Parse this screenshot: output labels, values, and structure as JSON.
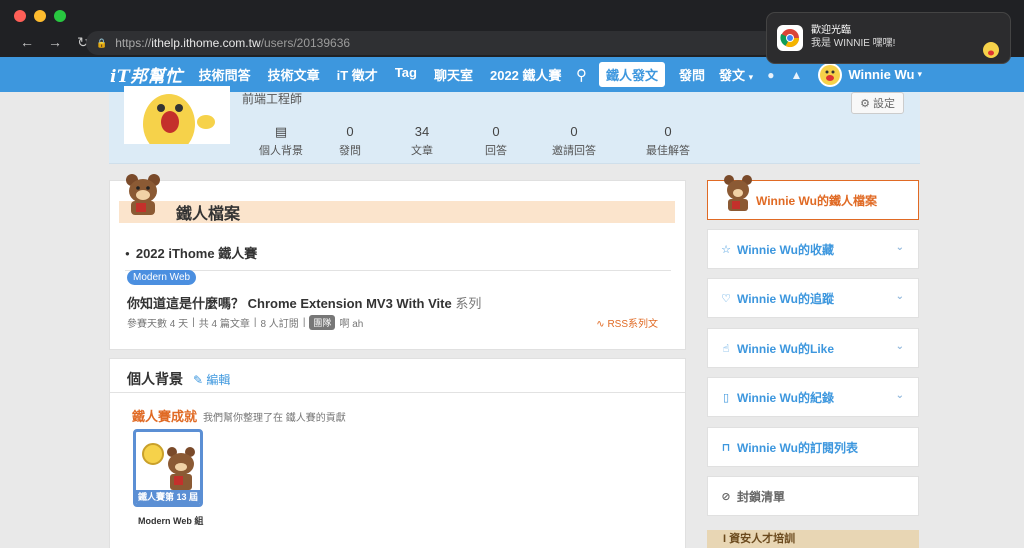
{
  "browser": {
    "url_scheme": "https://",
    "url_host": "ithelp.ithome.com.tw",
    "url_path": "/users/20139636"
  },
  "notification": {
    "title": "歡迎光臨",
    "message": "我是 WINNIE 嘿嘿!"
  },
  "site_nav": {
    "logo": "iT邦幫忙",
    "links": [
      "技術問答",
      "技術文章",
      "iT 徵才",
      "Tag",
      "聊天室",
      "2022 鐵人賽"
    ],
    "post_button": "鐵人發文",
    "ask": "發問",
    "write": "發文",
    "user_name": "Winnie Wu"
  },
  "profile": {
    "job_title": "前端工程師",
    "settings_label": "設定",
    "stats": [
      {
        "label": "個人背景",
        "value": ""
      },
      {
        "label": "發問",
        "value": "0"
      },
      {
        "label": "文章",
        "value": "34"
      },
      {
        "label": "回答",
        "value": "0"
      },
      {
        "label": "邀請回答",
        "value": "0"
      },
      {
        "label": "最佳解答",
        "value": "0"
      }
    ]
  },
  "ironman": {
    "heading": "鐵人檔案",
    "contest": "2022 iThome 鐵人賽",
    "tag": "Modern Web",
    "article_title": "你知道這是什麼嗎？ Chrome Extension MV3 With Vite",
    "article_series": "系列",
    "meta": [
      "參賽天數 4 天",
      "共 4 篇文章",
      "8 人訂閱"
    ],
    "team_badge": "團隊",
    "team_name": "啊 ah",
    "rss": "RSS系列文"
  },
  "background": {
    "title": "個人背景",
    "edit": "編輯",
    "achievement_title": "鐵人賽成就",
    "achievement_desc": "我們幫你整理了在 鐵人賽的貢獻",
    "badge_strip": "鐵人賽第 13 屆",
    "badge_caption": "Modern Web 組"
  },
  "sidebar": {
    "profile_link": "Winnie Wu的鐵人檔案",
    "items": [
      "Winnie Wu的收藏",
      "Winnie Wu的追蹤",
      "Winnie Wu的Like",
      "Winnie Wu的紀錄",
      "Winnie Wu的訂閱列表"
    ],
    "block_list": "封鎖清單",
    "promo": "I 資安人才培訓"
  },
  "colors": {
    "nav_blue": "#3d97de",
    "accent_orange": "#e06a24"
  }
}
